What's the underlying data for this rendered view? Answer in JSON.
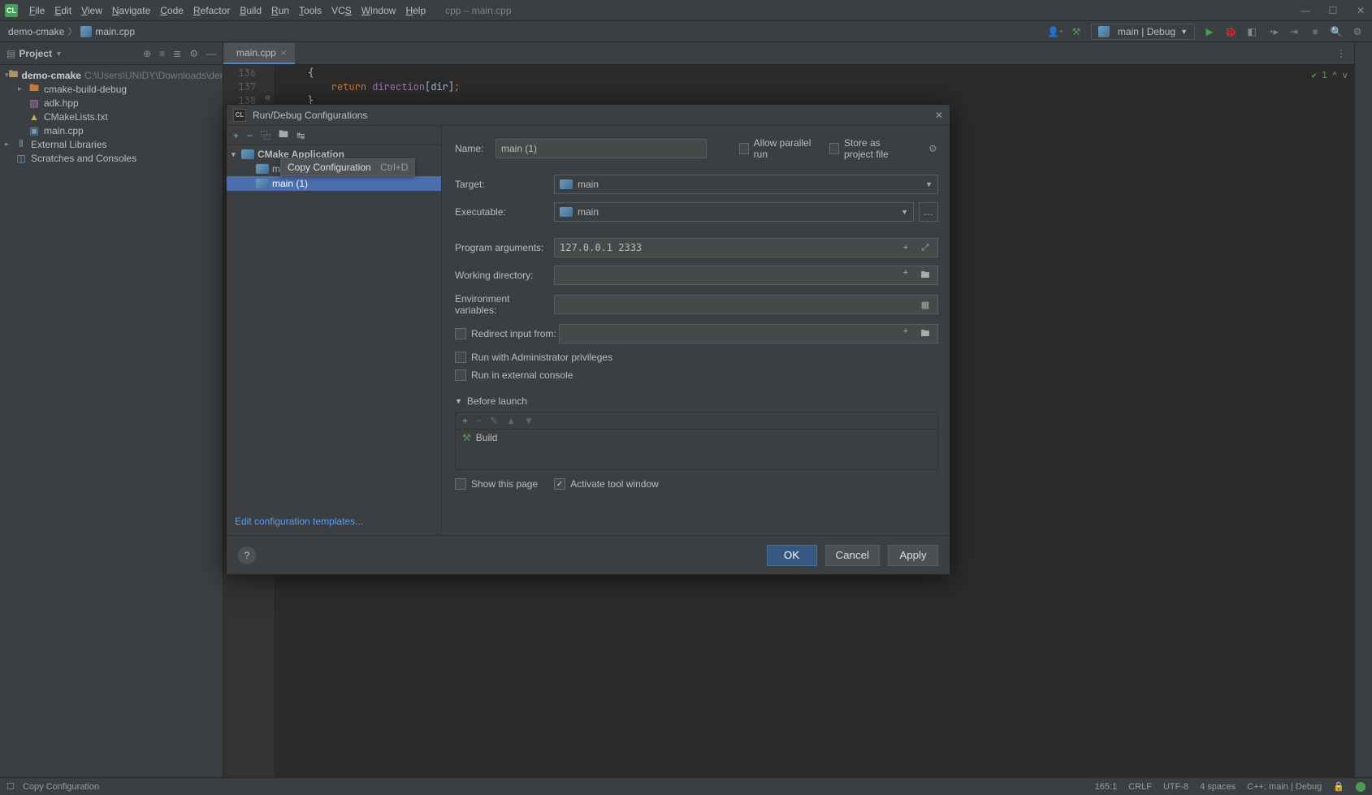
{
  "menubar": {
    "items": [
      "File",
      "Edit",
      "View",
      "Navigate",
      "Code",
      "Refactor",
      "Build",
      "Run",
      "Tools",
      "VCS",
      "Window",
      "Help"
    ],
    "title_hint": "cpp – main.cpp"
  },
  "breadcrumb": {
    "project": "demo-cmake",
    "file": "main.cpp"
  },
  "run_config_selector": "main | Debug",
  "project_panel": {
    "title": "Project",
    "root": "demo-cmake",
    "root_path": "C:\\Users\\UNIDY\\Downloads\\demo-cmake",
    "children": [
      {
        "type": "folder-orange",
        "name": "cmake-build-debug",
        "expandable": true
      },
      {
        "type": "hpp",
        "name": "adk.hpp"
      },
      {
        "type": "cmake",
        "name": "CMakeLists.txt"
      },
      {
        "type": "cpp",
        "name": "main.cpp"
      }
    ],
    "external_libs": "External Libraries",
    "scratches": "Scratches and Consoles"
  },
  "editor": {
    "tab": "main.cpp",
    "lines": {
      "136": "    {",
      "137": "        return direction[dir];",
      "138": "    }"
    },
    "inspection_count": "1"
  },
  "dialog": {
    "title": "Run/Debug Configurations",
    "tree": {
      "group": "CMake Application",
      "items": [
        "main",
        "main (1)"
      ]
    },
    "tooltip": {
      "label": "Copy Configuration",
      "shortcut": "Ctrl+D"
    },
    "templates_link": "Edit configuration templates...",
    "form": {
      "name_label": "Name:",
      "name_value": "main (1)",
      "allow_parallel": "Allow parallel run",
      "store_project": "Store as project file",
      "target_label": "Target:",
      "target_value": "main",
      "exec_label": "Executable:",
      "exec_value": "main",
      "args_label": "Program arguments:",
      "args_value": "127.0.0.1 2333",
      "workdir_label": "Working directory:",
      "env_label": "Environment variables:",
      "redirect_label": "Redirect input from:",
      "admin_label": "Run with Administrator privileges",
      "external_console_label": "Run in external console",
      "before_launch": "Before launch",
      "build_item": "Build",
      "show_this_page": "Show this page",
      "activate_tool": "Activate tool window"
    },
    "buttons": {
      "ok": "OK",
      "cancel": "Cancel",
      "apply": "Apply"
    }
  },
  "statusbar": {
    "hint": "Copy Configuration",
    "pos": "165:1",
    "eol": "CRLF",
    "encoding": "UTF-8",
    "indent": "4 spaces",
    "context": "C++: main | Debug"
  }
}
